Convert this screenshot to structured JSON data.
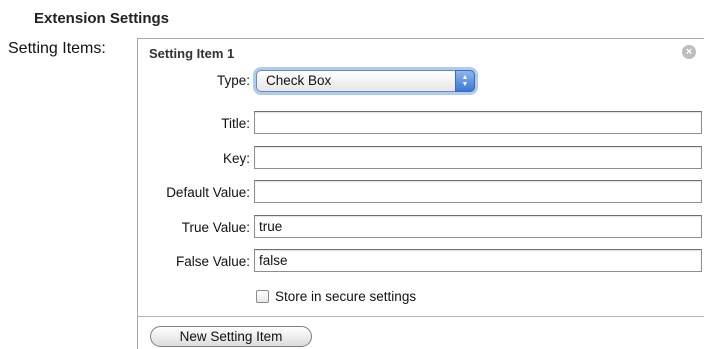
{
  "section_title": "Extension Settings",
  "setting_items_label": "Setting Items:",
  "item": {
    "title": "Setting Item 1",
    "close_icon": "close-circle-icon",
    "type_label": "Type:",
    "type_value": "Check Box",
    "select_arrows_icon": "up-down-arrows-icon",
    "title_label": "Title:",
    "title_value": "",
    "key_label": "Key:",
    "key_value": "",
    "default_value_label": "Default Value:",
    "default_value_value": "",
    "true_value_label": "True Value:",
    "true_value_value": "true",
    "false_value_label": "False Value:",
    "false_value_value": "false",
    "secure_checkbox_label": "Store in secure settings",
    "secure_checked": false
  },
  "new_item_button_label": "New Setting Item",
  "colors": {
    "select_focus_ring": "#6ea0e6",
    "select_arrow_fill": "#3b78d4",
    "close_button": "#bdbdbd"
  }
}
